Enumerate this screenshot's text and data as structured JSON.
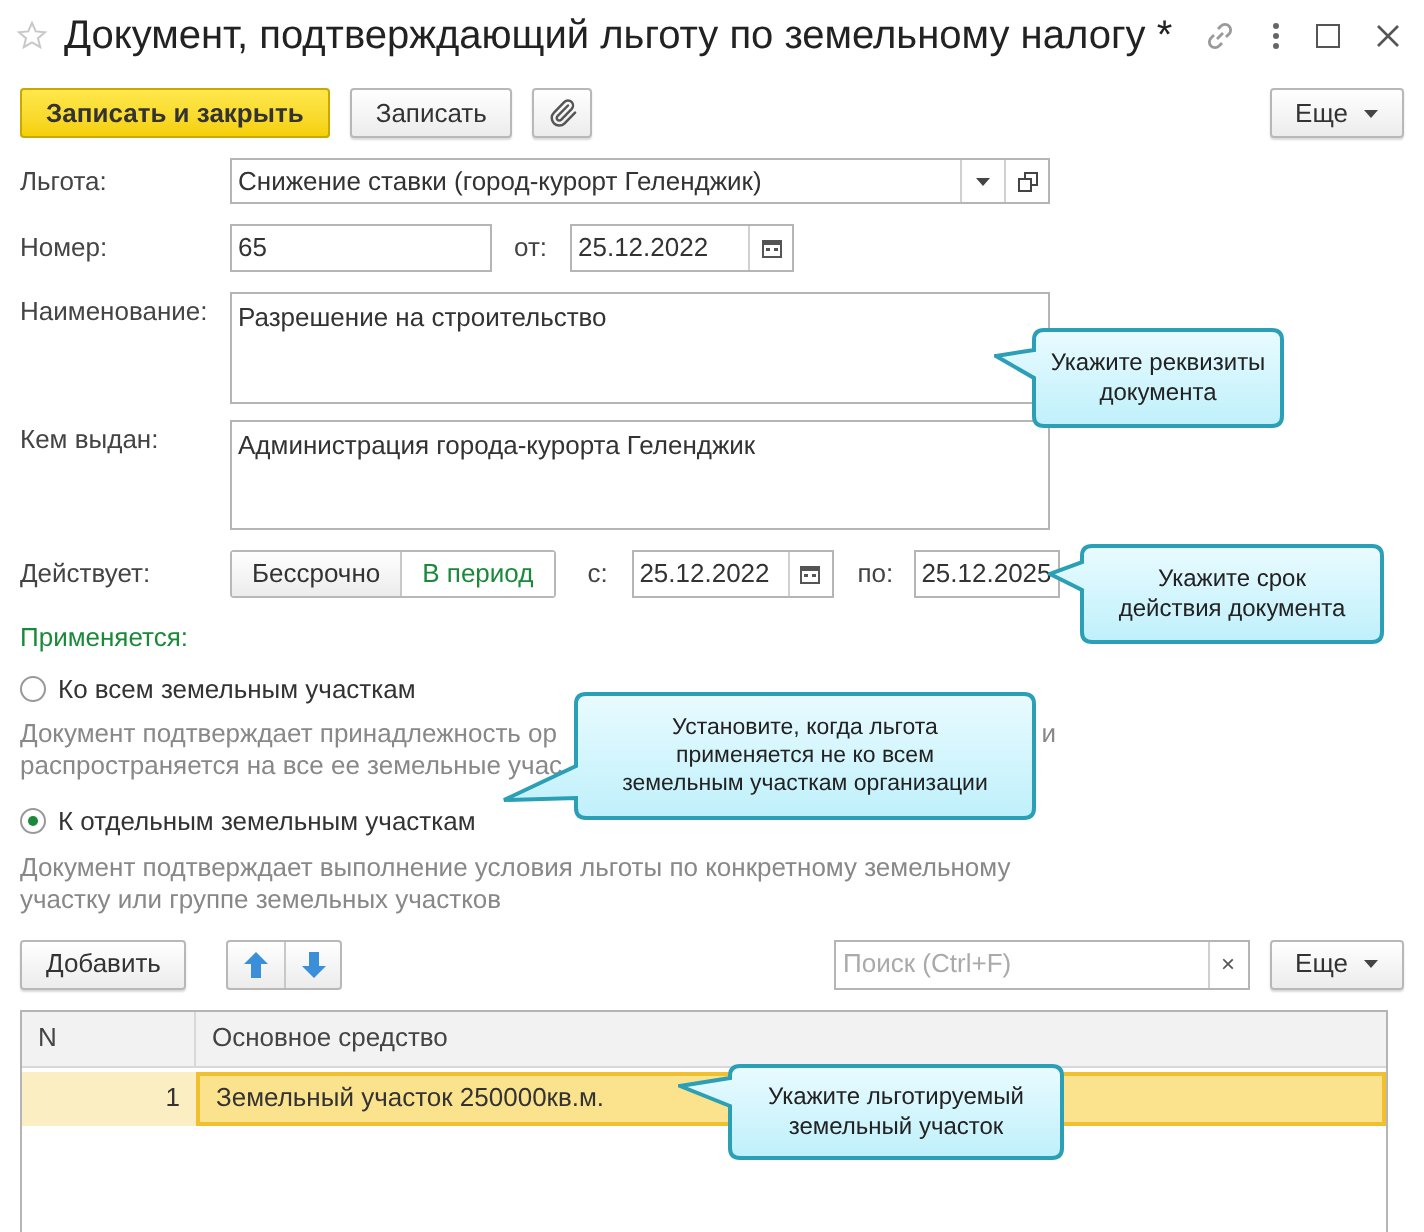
{
  "window": {
    "title": "Документ, подтверждающий льготу по земельному налогу *",
    "favorite": false
  },
  "toolbar": {
    "buttons": [
      {
        "kind": "primary",
        "label": "Записать и закрыть"
      },
      {
        "kind": "plain",
        "label": "Записать"
      },
      {
        "kind": "attach"
      }
    ],
    "more": "Еще"
  },
  "fields": {
    "benefit": {
      "label": "Льгота:",
      "value": "Снижение ставки (город-курорт Геленджик)"
    },
    "number": {
      "label": "Номер:",
      "value": "65",
      "date_label": "от:",
      "date": "25.12.2022"
    },
    "name": {
      "label": "Наименование:",
      "value": "Разрешение на строительство"
    },
    "issued_by": {
      "label": "Кем выдан:",
      "value": "Администрация города-курорта Геленджик"
    },
    "validity": {
      "label": "Действует:",
      "modes": [
        {
          "label": "Бессрочно",
          "selected": false
        },
        {
          "label": "В период",
          "selected": true
        }
      ],
      "from_label": "с:",
      "from": "25.12.2022",
      "to_label": "по:",
      "to": "25.12.2025"
    }
  },
  "applies": {
    "title": "Применяется:",
    "options": [
      {
        "label": "Ко всем земельным участкам",
        "selected": false,
        "description_lines": [
          "Документ подтверждает принадлежность ор",
          "распространяется на все ее земельные учас"
        ],
        "description_tail": "и"
      },
      {
        "label": "К отдельным земельным участкам",
        "selected": true,
        "description_lines": [
          "Документ подтверждает выполнение условия льготы по конкретному земельному",
          "участку или группе земельных участков"
        ]
      }
    ]
  },
  "table_toolbar": {
    "add": "Добавить",
    "search_placeholder": "Поиск (Ctrl+F)",
    "clear": "×",
    "more": "Еще"
  },
  "table": {
    "columns": [
      "N",
      "Основное средство"
    ],
    "rows": [
      {
        "cells": [
          "1",
          "Земельный участок 250000кв.м."
        ],
        "selected": true
      }
    ]
  },
  "callouts": [
    {
      "text": "Укажите реквизиты документа"
    },
    {
      "text": "Укажите срок действия документа"
    },
    {
      "text": "Установите, когда льгота применяется не ко всем земельным участкам организации"
    },
    {
      "text": "Укажите льготируемый земельный участок"
    }
  ]
}
